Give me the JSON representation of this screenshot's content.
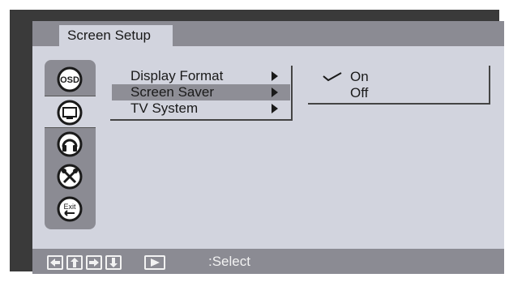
{
  "header": {
    "title": "Screen Setup"
  },
  "sidebar": {
    "items": [
      {
        "name": "osd",
        "icon": "osd-icon",
        "label": "OSD"
      },
      {
        "name": "screen",
        "icon": "monitor-icon",
        "selected": true
      },
      {
        "name": "audio",
        "icon": "headphones-icon"
      },
      {
        "name": "tools",
        "icon": "tools-icon"
      },
      {
        "name": "exit",
        "icon": "exit-icon",
        "label": "Exit"
      }
    ]
  },
  "menu": {
    "items": [
      {
        "label": "Display Format",
        "selected": false
      },
      {
        "label": "Screen Saver",
        "selected": true
      },
      {
        "label": "TV System",
        "selected": false
      }
    ]
  },
  "submenu": {
    "options": [
      {
        "label": "On",
        "checked": true
      },
      {
        "label": "Off",
        "checked": false
      }
    ]
  },
  "footer": {
    "nav_keys": [
      "left-arrow-icon",
      "up-arrow-icon",
      "right-arrow-icon",
      "down-arrow-icon"
    ],
    "select_key": "play-icon",
    "select_label": ":Select"
  },
  "colors": {
    "frame": "#3a3a3a",
    "panel": "#d2d4de",
    "bar": "#8b8b93",
    "highlight": "#8e8e96"
  }
}
